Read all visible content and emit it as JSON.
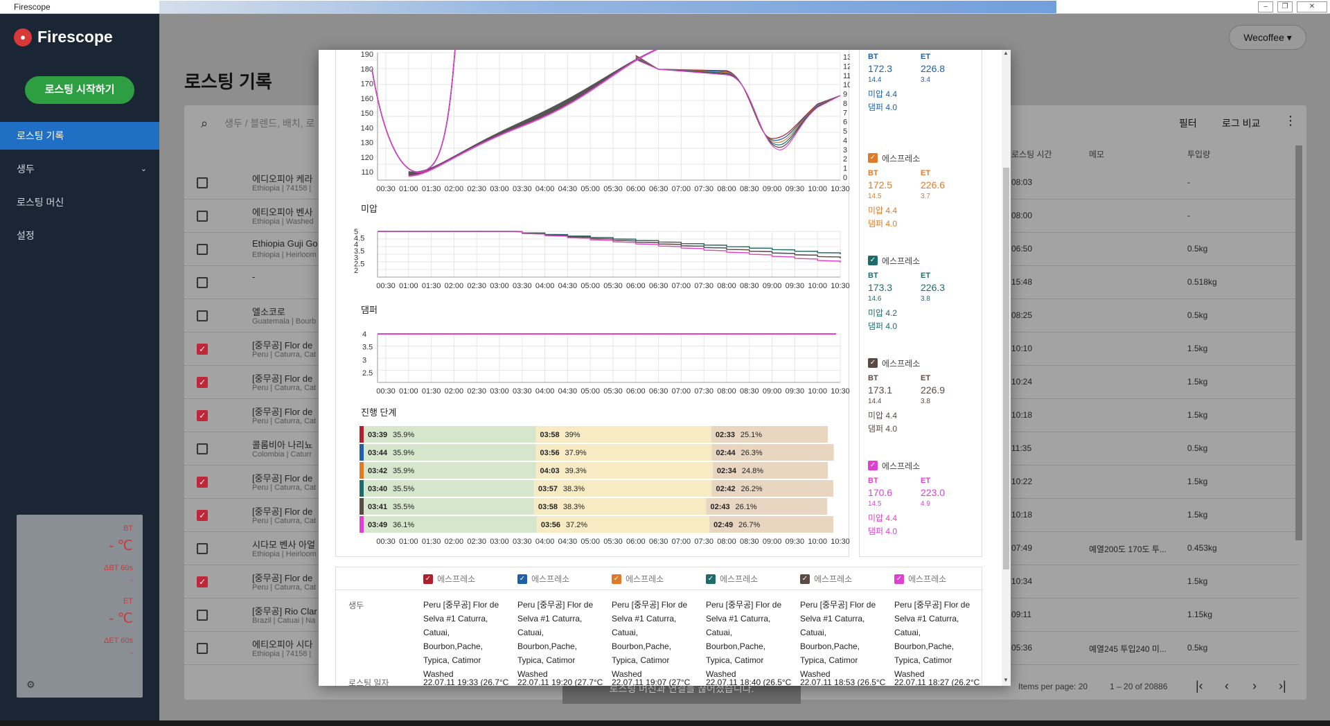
{
  "window": {
    "title": "Firescope"
  },
  "sidebar": {
    "brand": "Firescope",
    "start_button": "로스팅 시작하기",
    "items": [
      {
        "label": "로스팅 기록",
        "active": true
      },
      {
        "label": "생두",
        "has_children": true
      },
      {
        "label": "로스팅 머신"
      },
      {
        "label": "설정"
      }
    ],
    "temps": {
      "bt_label": "BT",
      "bt_value": "- ℃",
      "dbt_label": "ΔBT 60s",
      "dbt_value": "-",
      "et_label": "ET",
      "et_value": "- ℃",
      "det_label": "ΔET 60s",
      "det_value": "-"
    }
  },
  "header": {
    "title": "로스팅 기록",
    "user": "Wecoffee"
  },
  "toolbar": {
    "search_placeholder": "생두 / 블렌드, 배치, 로",
    "filter": "필터",
    "compare": "로그 비교"
  },
  "table": {
    "headers": [
      "로스팅 시간",
      "메모",
      "투입량"
    ],
    "rows": [
      {
        "checked": false,
        "name": "에디오피아 케라",
        "sub": "Ethiopia | 74158 |",
        "time": "08:03",
        "memo": "",
        "amount": "-"
      },
      {
        "checked": false,
        "name": "에티오피아 벤사",
        "sub": "Ethiopia | Washed",
        "time": "08:00",
        "memo": "",
        "amount": "-"
      },
      {
        "checked": false,
        "name": "Ethiopia Guji Go",
        "sub": "Ethiopia | Heirloom",
        "time": "06:50",
        "memo": "",
        "amount": "0.5kg"
      },
      {
        "checked": false,
        "name": "-",
        "sub": "",
        "time": "15:48",
        "memo": "",
        "amount": "0.518kg"
      },
      {
        "checked": false,
        "name": "엘소코로",
        "sub": "Guatemala | Bourb",
        "time": "08:25",
        "memo": "",
        "amount": "0.5kg"
      },
      {
        "checked": true,
        "name": "[중무공] Flor de",
        "sub": "Peru | Caturra, Cat",
        "time": "10:10",
        "memo": "",
        "amount": "1.5kg"
      },
      {
        "checked": true,
        "name": "[중무공] Flor de",
        "sub": "Peru | Caturra, Cat",
        "time": "10:24",
        "memo": "",
        "amount": "1.5kg"
      },
      {
        "checked": true,
        "name": "[중무공] Flor de",
        "sub": "Peru | Caturra, Cat",
        "time": "10:18",
        "memo": "",
        "amount": "1.5kg"
      },
      {
        "checked": false,
        "name": "콜롬비아 나리뇨",
        "sub": "Colombia | Caturr",
        "time": "11:35",
        "memo": "",
        "amount": "0.5kg"
      },
      {
        "checked": true,
        "name": "[중무공] Flor de",
        "sub": "Peru | Caturra, Cat",
        "time": "10:22",
        "memo": "",
        "amount": "1.5kg"
      },
      {
        "checked": true,
        "name": "[중무공] Flor de",
        "sub": "Peru | Caturra, Cat",
        "time": "10:18",
        "memo": "",
        "amount": "1.5kg"
      },
      {
        "checked": false,
        "name": "시다모 벤사 아얼",
        "sub": "Ethiopia | Heirloom",
        "time": "07:49",
        "memo": "예열200도 170도 투...",
        "amount": "0.453kg"
      },
      {
        "checked": true,
        "name": "[중무공] Flor de",
        "sub": "Peru | Caturra, Cat",
        "time": "10:34",
        "memo": "",
        "amount": "1.5kg"
      },
      {
        "checked": false,
        "name": "[중무공] Rio Clar",
        "sub": "Brazil | Catuai | Na",
        "time": "09:11",
        "memo": "",
        "amount": "1.15kg"
      },
      {
        "checked": false,
        "name": "에티오피아 시다",
        "sub": "Ethiopia | 74158 |",
        "time": "05:36",
        "memo": "예열245 투입240 미...",
        "amount": "0.5kg"
      }
    ],
    "pager": {
      "per_page": "Items per page: 20",
      "range": "1 – 20 of 20886"
    }
  },
  "snackbar": "로스팅 머신과 연결을 끊어졌습니다.",
  "modal": {
    "temp_axis_left": [
      190,
      180,
      170,
      160,
      150,
      140,
      130,
      120,
      110
    ],
    "ror_axis_right": [
      13,
      12,
      11,
      10,
      9,
      8,
      7,
      6,
      5,
      4,
      3,
      2,
      1,
      0
    ],
    "time_ticks": [
      "00:30",
      "01:00",
      "01:30",
      "02:00",
      "02:30",
      "03:00",
      "03:30",
      "04:00",
      "04:30",
      "05:00",
      "05:30",
      "06:00",
      "06:30",
      "07:00",
      "07:30",
      "08:00",
      "08:30",
      "09:00",
      "09:30",
      "10:00",
      "10:30"
    ],
    "fan_title": "미압",
    "fan_axis": [
      "5",
      "4.5",
      "4",
      "3.5",
      "3",
      "2.5",
      "2"
    ],
    "damper_title": "댐퍼",
    "damper_axis": [
      "4",
      "3.5",
      "3",
      "2.5"
    ],
    "phase_title": "진행 단계",
    "phases": [
      {
        "color": "#b0202c",
        "dry": "03:39",
        "dry_pct": "35.9%",
        "mai": "03:58",
        "mai_pct": "39%",
        "dev": "02:33",
        "dev_pct": "25.1%"
      },
      {
        "color": "#1f5fa8",
        "dry": "03:44",
        "dry_pct": "35.9%",
        "mai": "03:56",
        "mai_pct": "37.9%",
        "dev": "02:44",
        "dev_pct": "26.3%"
      },
      {
        "color": "#e07a2a",
        "dry": "03:42",
        "dry_pct": "35.9%",
        "mai": "04:03",
        "mai_pct": "39.3%",
        "dev": "02:34",
        "dev_pct": "24.8%"
      },
      {
        "color": "#1e6b6b",
        "dry": "03:40",
        "dry_pct": "35.5%",
        "mai": "03:57",
        "mai_pct": "38.3%",
        "dev": "02:42",
        "dev_pct": "26.2%"
      },
      {
        "color": "#5a4a44",
        "dry": "03:41",
        "dry_pct": "35.5%",
        "mai": "03:58",
        "mai_pct": "38.3%",
        "dev": "02:43",
        "dev_pct": "26.1%"
      },
      {
        "color": "#e040d0",
        "dry": "03:49",
        "dry_pct": "36.1%",
        "mai": "03:56",
        "mai_pct": "37.2%",
        "dev": "02:49",
        "dev_pct": "26.7%"
      }
    ],
    "legend": [
      {
        "name": "",
        "color": "#1f5fa8",
        "bt": "172.3",
        "et": "226.8",
        "bt_ror": "14.4",
        "et_ror": "3.4",
        "fan": "미압 4.4",
        "damper": "댐퍼 4.0",
        "show_head": false
      },
      {
        "name": "에스프레소",
        "color": "#e07a2a",
        "bt": "172.5",
        "et": "226.6",
        "bt_ror": "14.5",
        "et_ror": "3.7",
        "fan": "미압 4.4",
        "damper": "댐퍼 4.0",
        "show_head": true
      },
      {
        "name": "에스프레소",
        "color": "#1e6b6b",
        "bt": "173.3",
        "et": "226.3",
        "bt_ror": "14.6",
        "et_ror": "3.8",
        "fan": "미압 4.2",
        "damper": "댐퍼 4.0",
        "show_head": true
      },
      {
        "name": "에스프레소",
        "color": "#5a4a44",
        "bt": "173.1",
        "et": "226.9",
        "bt_ror": "14.4",
        "et_ror": "3.8",
        "fan": "미압 4.4",
        "damper": "댐퍼 4.0",
        "show_head": true
      },
      {
        "name": "에스프레소",
        "color": "#e040d0",
        "bt": "170.6",
        "et": "223.0",
        "bt_ror": "14.5",
        "et_ror": "4.9",
        "fan": "미압 4.4",
        "damper": "댐퍼 4.0",
        "show_head": true
      }
    ],
    "legend_labels": {
      "bt": "BT",
      "et": "ET"
    },
    "compare": {
      "columns": [
        {
          "name": "에스프레소",
          "color": "#b0202c"
        },
        {
          "name": "에스프레소",
          "color": "#1f5fa8"
        },
        {
          "name": "에스프레소",
          "color": "#e07a2a"
        },
        {
          "name": "에스프레소",
          "color": "#1e6b6b"
        },
        {
          "name": "에스프레소",
          "color": "#5a4a44"
        },
        {
          "name": "에스프레소",
          "color": "#e040d0"
        }
      ],
      "bean_label": "생두",
      "bean_value": [
        "Peru [중무공] Flor de",
        "Selva #1 Caturra,",
        "Catuai, Bourbon,Pache,",
        "Typica, Catimor",
        "Washed"
      ],
      "date_label": "로스팅 일자",
      "dates": [
        "22.07.11 19:33 (26.7°C",
        "22.07.11 19:20 (27.7°C",
        "22.07.11 19:07 (27°C",
        "22.07.11 18:40 (26.5°C",
        "22.07.11 18:53 (26.5°C",
        "22.07.11 18:27 (26.2°C"
      ]
    }
  }
}
